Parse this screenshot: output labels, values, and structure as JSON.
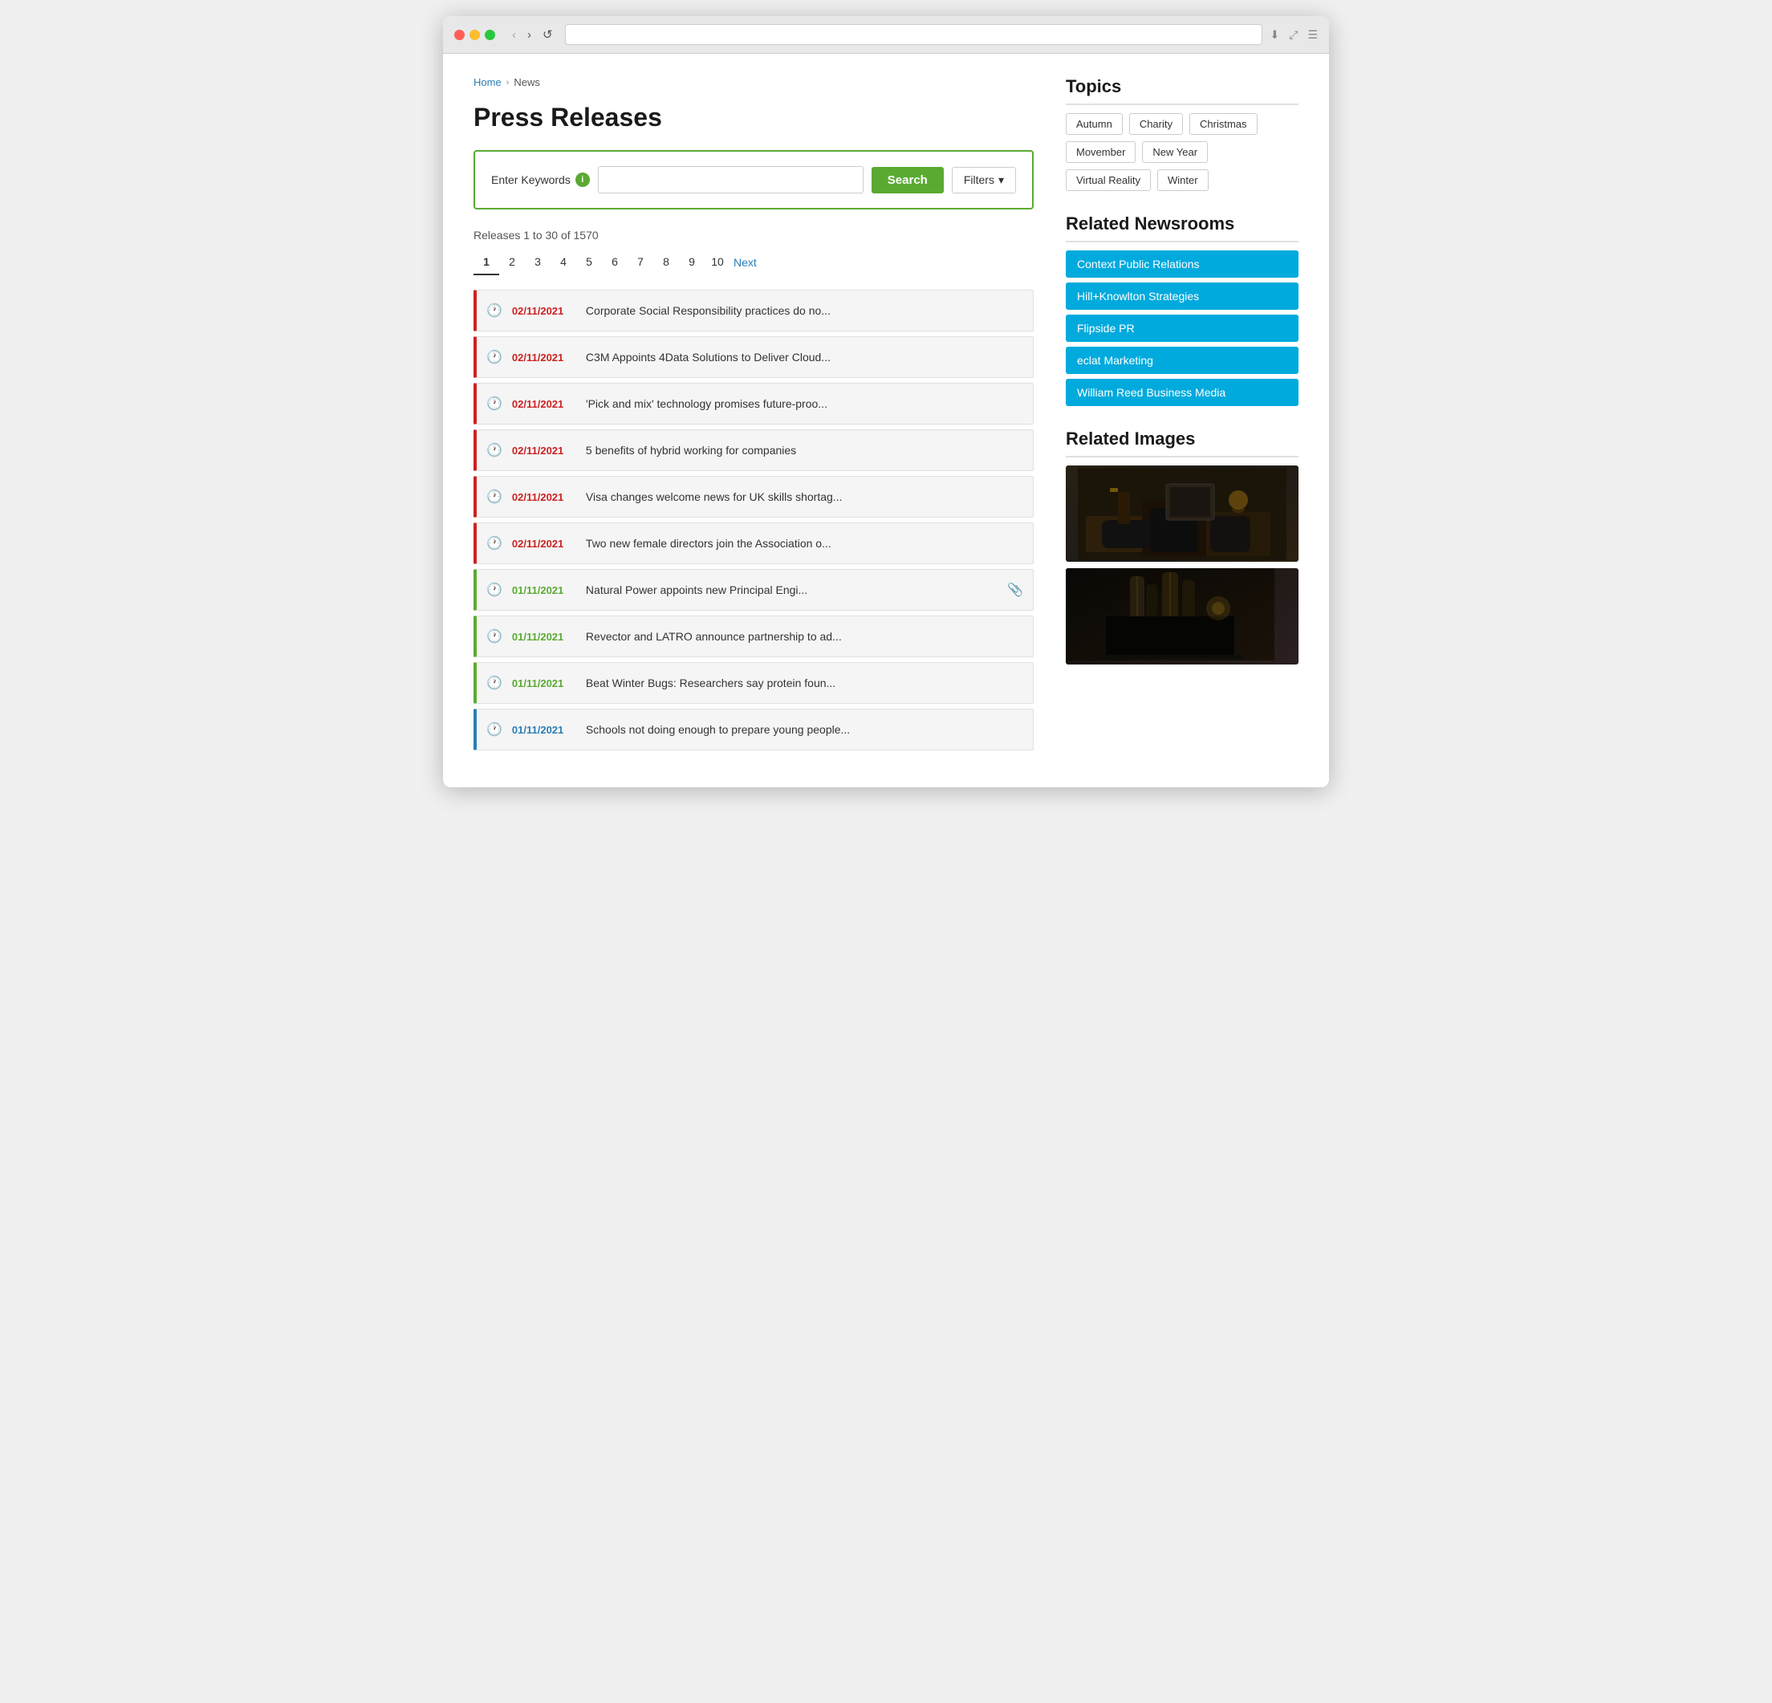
{
  "browser": {
    "back_label": "‹",
    "forward_label": "›",
    "refresh_label": "↺",
    "download_icon": "⬇",
    "expand_icon": "⤢",
    "menu_icon": "☰"
  },
  "breadcrumb": {
    "home_label": "Home",
    "separator": "›",
    "current": "News"
  },
  "page": {
    "title": "Press Releases"
  },
  "search": {
    "label": "Enter Keywords",
    "info_icon": "i",
    "placeholder": "",
    "search_btn": "Search",
    "filters_btn": "Filters",
    "filters_arrow": "▾"
  },
  "results": {
    "count_text": "Releases 1 to 30 of 1570"
  },
  "pagination": {
    "pages": [
      "1",
      "2",
      "3",
      "4",
      "5",
      "6",
      "7",
      "8",
      "9",
      "10"
    ],
    "next_label": "Next",
    "active_page": "1"
  },
  "news_items": [
    {
      "date": "02/11/2021",
      "title": "Corporate Social Responsibility practices do no...",
      "color": "red",
      "attachment": false
    },
    {
      "date": "02/11/2021",
      "title": "C3M Appoints 4Data Solutions to Deliver Cloud...",
      "color": "red",
      "attachment": false
    },
    {
      "date": "02/11/2021",
      "title": "'Pick and mix' technology promises future-proo...",
      "color": "red",
      "attachment": false
    },
    {
      "date": "02/11/2021",
      "title": "5 benefits of hybrid working for companies",
      "color": "red",
      "attachment": false
    },
    {
      "date": "02/11/2021",
      "title": "Visa changes welcome news for UK skills shortag...",
      "color": "red",
      "attachment": false
    },
    {
      "date": "02/11/2021",
      "title": "Two new female directors join the Association o...",
      "color": "red",
      "attachment": false
    },
    {
      "date": "01/11/2021",
      "title": "Natural Power appoints new Principal Engi...",
      "color": "green",
      "attachment": true
    },
    {
      "date": "01/11/2021",
      "title": "Revector and LATRO announce partnership to ad...",
      "color": "green",
      "attachment": false
    },
    {
      "date": "01/11/2021",
      "title": "Beat Winter Bugs: Researchers say protein foun...",
      "color": "green",
      "attachment": false
    },
    {
      "date": "01/11/2021",
      "title": "Schools not doing enough to prepare young people...",
      "color": "blue",
      "attachment": false
    }
  ],
  "sidebar": {
    "topics_title": "Topics",
    "topics": [
      "Autumn",
      "Charity",
      "Christmas",
      "Movember",
      "New Year",
      "Virtual Reality",
      "Winter"
    ],
    "newsrooms_title": "Related Newsrooms",
    "newsrooms": [
      "Context Public Relations",
      "Hill+Knowlton Strategies",
      "Flipside PR",
      "eclat Marketing",
      "William Reed Business Media"
    ],
    "images_title": "Related Images"
  }
}
